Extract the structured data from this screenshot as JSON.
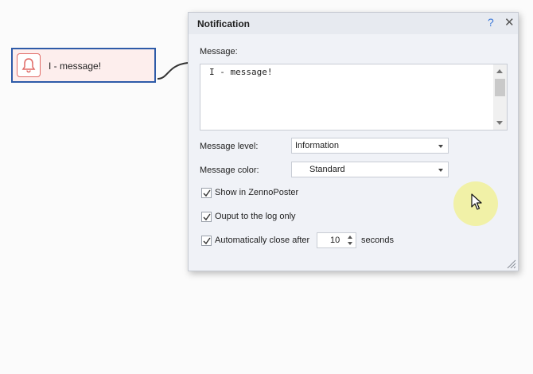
{
  "node": {
    "label": "I - message!",
    "icon": "bell-icon",
    "border_color": "#2e5ba8",
    "background": "#fdeeed",
    "icon_color": "#e06a66"
  },
  "dialog": {
    "title": "Notification",
    "help_label": "?",
    "close_label": "✕",
    "message_label": "Message:",
    "message_text": "I - message!",
    "level_label": "Message level:",
    "level_value": "Information",
    "color_label": "Message color:",
    "color_value": "Standard",
    "checkboxes": [
      {
        "label": "Show in ZennoPoster",
        "checked": true
      },
      {
        "label": "Ouput to the log only",
        "checked": true
      },
      {
        "label": "Automatically close after",
        "checked": true
      }
    ],
    "close_after_value": "10",
    "close_after_unit": "seconds",
    "accent_color": "#3b78d8"
  }
}
